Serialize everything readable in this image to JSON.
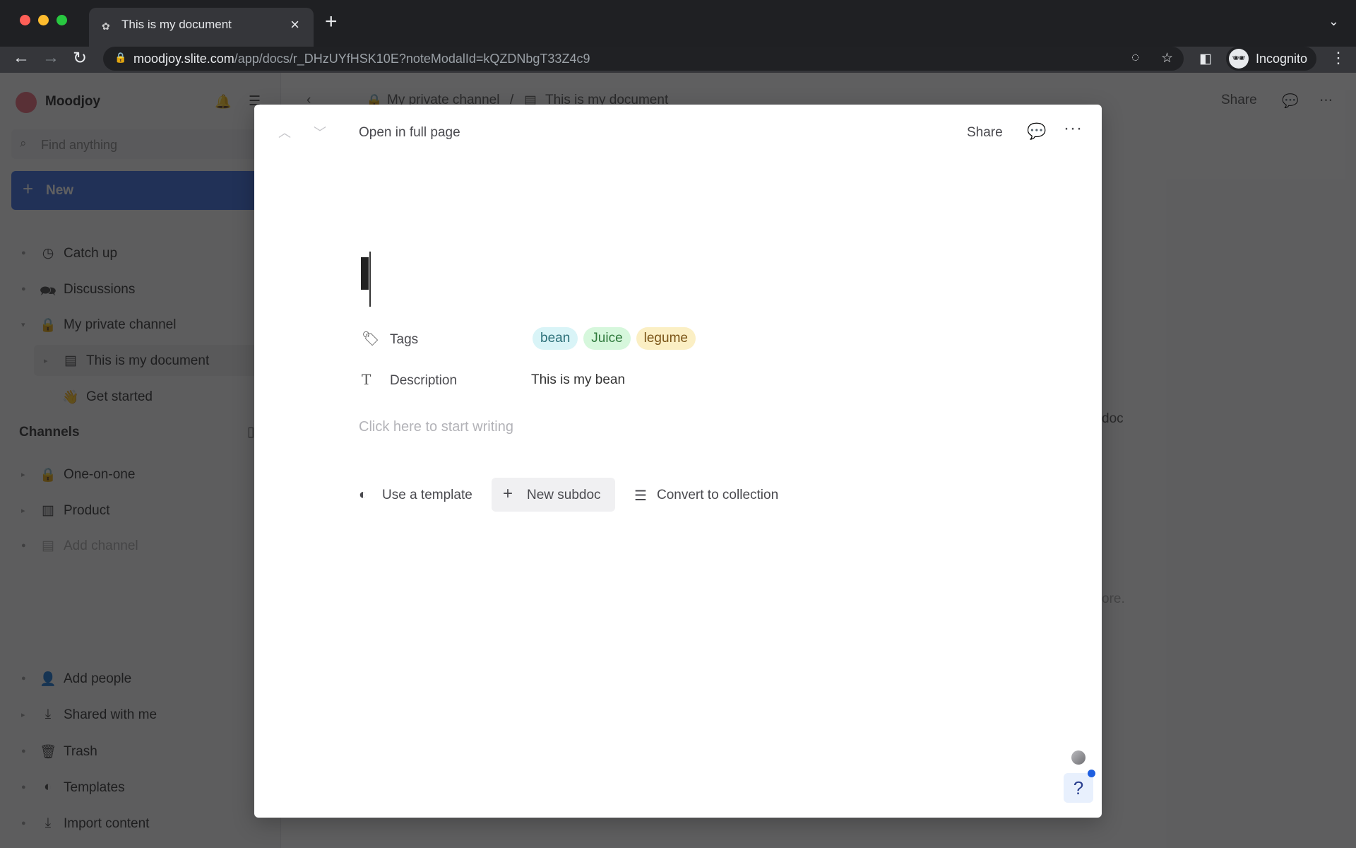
{
  "browser": {
    "tab_title": "This is my document",
    "url_host": "moodjoy.slite.com",
    "url_path": "/app/docs/r_DHzUYfHSK10E?noteModalId=kQZDNbgT33Z4c9",
    "profile_label": "Incognito"
  },
  "sidebar": {
    "workspace_name": "Moodjoy",
    "search_placeholder": "Find anything",
    "new_label": "New",
    "top_items": [
      {
        "label": "Catch up",
        "icon": "clock-icon"
      },
      {
        "label": "Discussions",
        "icon": "discussions-icon"
      },
      {
        "label": "My private channel",
        "icon": "lock-icon"
      }
    ],
    "private_children": [
      {
        "label": "This is my document",
        "icon": "document-icon"
      },
      {
        "label": "Get started",
        "icon": "wave-hand-icon"
      }
    ],
    "channels_title": "Channels",
    "channels": [
      {
        "label": "One-on-one",
        "icon": "lock-icon"
      },
      {
        "label": "Product",
        "icon": "channel-icon"
      },
      {
        "label": "Add channel",
        "icon": "add-channel-icon"
      }
    ],
    "bottom_items": [
      {
        "label": "Add people",
        "icon": "add-person-icon"
      },
      {
        "label": "Shared with me",
        "icon": "inbox-download-icon"
      },
      {
        "label": "Trash",
        "icon": "trash-icon"
      },
      {
        "label": "Templates",
        "icon": "template-icon"
      },
      {
        "label": "Import content",
        "icon": "import-icon"
      }
    ]
  },
  "background_doc": {
    "breadcrumb": [
      "My private channel",
      "This is my document"
    ],
    "share_label": "Share",
    "partial_text_1": "doc",
    "partial_text_2": "ore."
  },
  "modal": {
    "open_full_label": "Open in full page",
    "share_label": "Share",
    "properties": {
      "tags_label": "Tags",
      "tags": [
        {
          "label": "bean",
          "bg": "#d9f4f7",
          "fg": "#2b6f78"
        },
        {
          "label": "Juice",
          "bg": "#d6f7dc",
          "fg": "#2f7a3c"
        },
        {
          "label": "legume",
          "bg": "#fbefc4",
          "fg": "#7a5416"
        }
      ],
      "description_label": "Description",
      "description_value": "This is my bean"
    },
    "placeholder": "Click here to start writing",
    "actions": {
      "use_template": "Use a template",
      "new_subdoc": "New subdoc",
      "convert_collection": "Convert to collection"
    },
    "help_label": "?"
  }
}
